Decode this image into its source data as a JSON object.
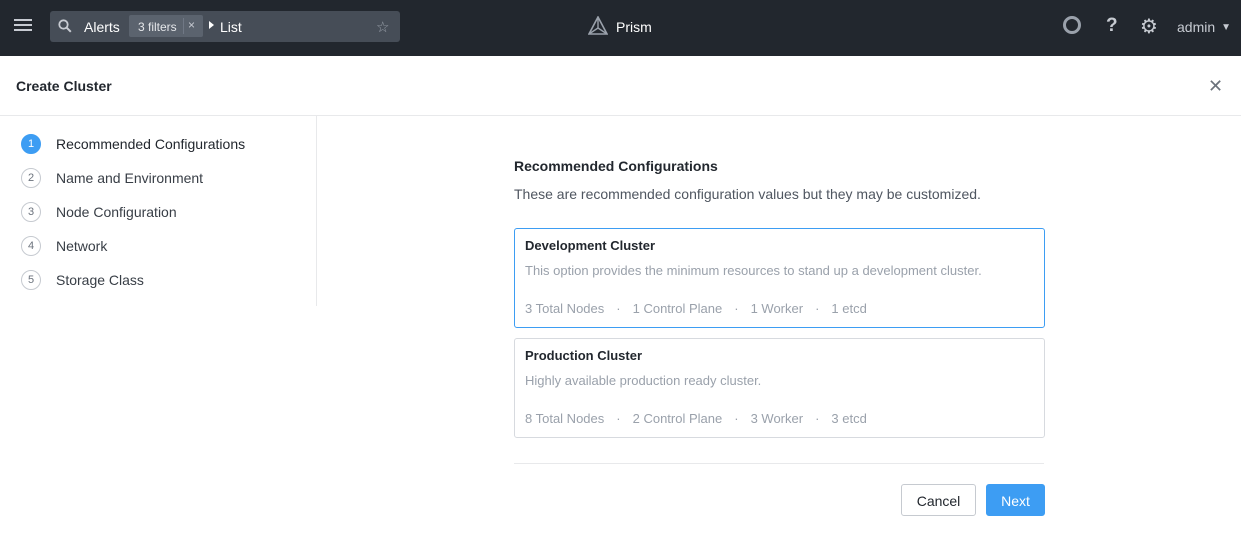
{
  "topbar": {
    "search": {
      "entity": "Alerts",
      "filter_chip": "3 filters",
      "filter_clear": "×",
      "view": "List",
      "star": "☆"
    },
    "brand": "Prism",
    "help": "?",
    "gear": "⚙",
    "user": "admin",
    "user_chevron": "⌄"
  },
  "modal": {
    "title": "Create Cluster",
    "close": "✕"
  },
  "steps": [
    {
      "num": "1",
      "label": "Recommended Configurations",
      "active": true
    },
    {
      "num": "2",
      "label": "Name and Environment",
      "active": false
    },
    {
      "num": "3",
      "label": "Node Configuration",
      "active": false
    },
    {
      "num": "4",
      "label": "Network",
      "active": false
    },
    {
      "num": "5",
      "label": "Storage Class",
      "active": false
    }
  ],
  "content": {
    "title": "Recommended Configurations",
    "description": "These are recommended configuration values but they may be customized.",
    "cards": [
      {
        "title": "Development Cluster",
        "description": "This option provides the minimum resources to stand up a development cluster.",
        "stats": [
          "3 Total Nodes",
          "1 Control Plane",
          "1 Worker",
          "1 etcd"
        ],
        "selected": true
      },
      {
        "title": "Production Cluster",
        "description": "Highly available production ready cluster.",
        "stats": [
          "8 Total Nodes",
          "2 Control Plane",
          "3 Worker",
          "3 etcd"
        ],
        "selected": false
      }
    ],
    "separator": "·"
  },
  "buttons": {
    "cancel": "Cancel",
    "next": "Next"
  },
  "colors": {
    "topbar_bg": "#22272e",
    "accent": "#3d9df3"
  },
  "icons": [
    "menu-icon",
    "search-icon",
    "star-icon",
    "prism-logo-icon",
    "status-circle-icon",
    "help-icon",
    "gear-icon",
    "close-icon"
  ]
}
